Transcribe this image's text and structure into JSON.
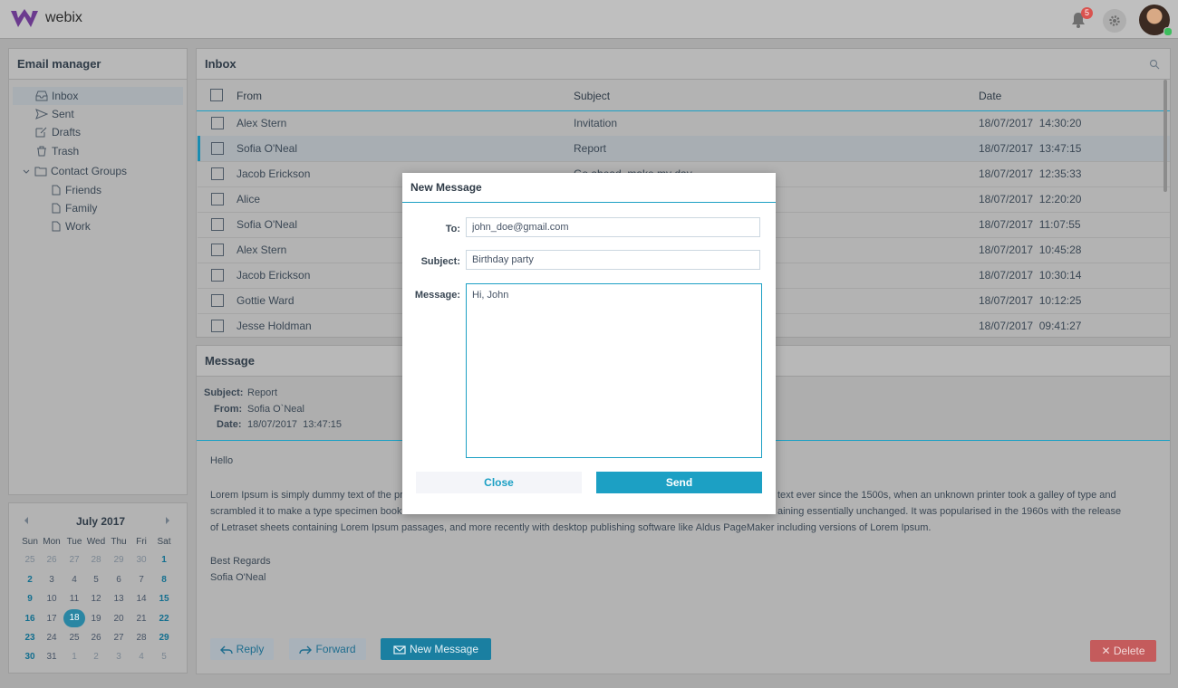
{
  "app": {
    "brand": "webix",
    "notification_count": "5"
  },
  "sidebar": {
    "title": "Email manager",
    "items": [
      {
        "label": "Inbox",
        "icon": "inbox-icon"
      },
      {
        "label": "Sent",
        "icon": "send-icon"
      },
      {
        "label": "Drafts",
        "icon": "drafts-icon"
      },
      {
        "label": "Trash",
        "icon": "trash-icon"
      },
      {
        "label": "Contact Groups",
        "icon": "folder-icon"
      },
      {
        "label": "Friends",
        "icon": "file-icon"
      },
      {
        "label": "Family",
        "icon": "file-icon"
      },
      {
        "label": "Work",
        "icon": "file-icon"
      }
    ]
  },
  "calendar": {
    "month_label": "July 2017",
    "days_of_week": [
      "Sun",
      "Mon",
      "Tue",
      "Wed",
      "Thu",
      "Fri",
      "Sat"
    ],
    "weeks": [
      [
        "25",
        "26",
        "27",
        "28",
        "29",
        "30",
        "1"
      ],
      [
        "2",
        "3",
        "4",
        "5",
        "6",
        "7",
        "8"
      ],
      [
        "9",
        "10",
        "11",
        "12",
        "13",
        "14",
        "15"
      ],
      [
        "16",
        "17",
        "18",
        "19",
        "20",
        "21",
        "22"
      ],
      [
        "23",
        "24",
        "25",
        "26",
        "27",
        "28",
        "29"
      ],
      [
        "30",
        "31",
        "1",
        "2",
        "3",
        "4",
        "5"
      ]
    ],
    "selected_day": "18"
  },
  "inbox": {
    "title": "Inbox",
    "columns": {
      "from": "From",
      "subject": "Subject",
      "date": "Date"
    },
    "rows": [
      {
        "from": "Alex Stern",
        "subject": "Invitation",
        "date": "18/07/2017  14:30:20"
      },
      {
        "from": "Sofia O'Neal",
        "subject": "Report",
        "date": "18/07/2017  13:47:15"
      },
      {
        "from": "Jacob Erickson",
        "subject": "Go ahead, make my day",
        "date": "18/07/2017  12:35:33"
      },
      {
        "from": "Alice",
        "subject": "",
        "date": "18/07/2017  12:20:20"
      },
      {
        "from": "Sofia O'Neal",
        "subject": "",
        "date": "18/07/2017  11:07:55"
      },
      {
        "from": "Alex Stern",
        "subject": "",
        "date": "18/07/2017  10:45:28"
      },
      {
        "from": "Jacob Erickson",
        "subject": "",
        "date": "18/07/2017  10:30:14"
      },
      {
        "from": "Gottie Ward",
        "subject": "",
        "date": "18/07/2017  10:12:25"
      },
      {
        "from": "Jesse Holdman",
        "subject": "",
        "date": "18/07/2017  09:41:27"
      }
    ]
  },
  "message": {
    "title": "Message",
    "subject_label": "Subject:",
    "subject": "Report",
    "from_label": "From:",
    "from": "Sofia O`Neal",
    "date_label": "Date:",
    "date": "18/07/2017  13:47:15",
    "greeting": "Hello",
    "body_line1_left": "Lorem Ipsum is simply dummy text of the pr",
    "body_line1_right": "text ever since the 1500s, when an unknown printer took a galley of type and",
    "body_line2_left": "scrambled it to make a type specimen book.",
    "body_line2_right": "aining essentially unchanged. It was popularised in the 1960s with the release",
    "body_line3": "of Letraset sheets containing Lorem Ipsum passages, and more recently with desktop publishing software like Aldus PageMaker including versions of Lorem Ipsum.",
    "regards": "Best Regards",
    "signature": "Sofia O'Neal",
    "reply_label": "Reply",
    "forward_label": "Forward",
    "new_message_label": "New Message",
    "delete_label": "Delete"
  },
  "modal": {
    "title": "New Message",
    "to_label": "To:",
    "to_value": "john_doe@gmail.com",
    "subject_label": "Subject:",
    "subject_value": "Birthday party",
    "message_label": "Message:",
    "message_value": "Hi, John\n",
    "close_label": "Close",
    "send_label": "Send"
  },
  "colors": {
    "accent": "#1ca0c4",
    "danger": "#e05d5f",
    "brand": "#7b3fa0"
  }
}
